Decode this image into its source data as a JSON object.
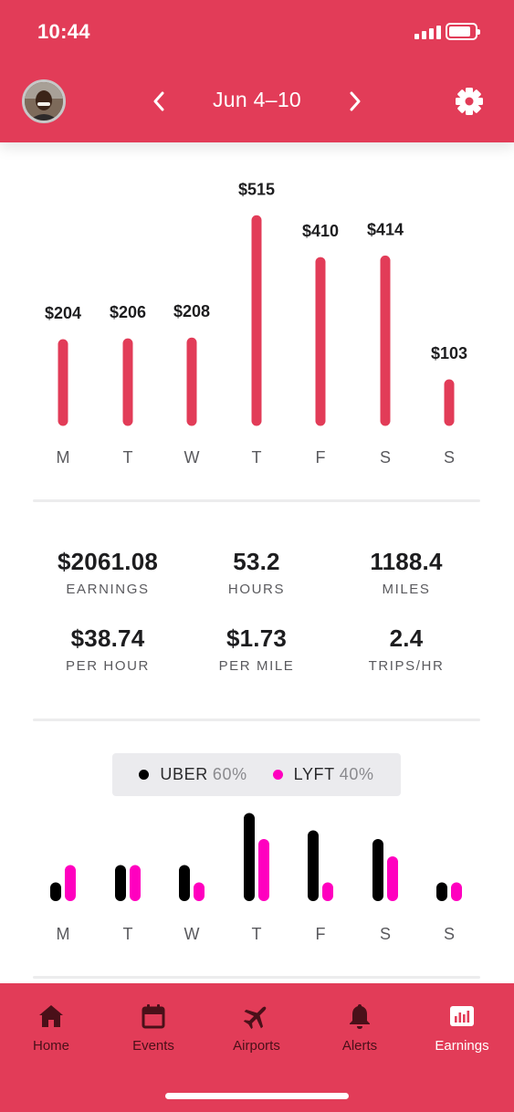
{
  "status_bar": {
    "time": "10:44",
    "battery_level": 0.85
  },
  "header": {
    "week_label": "Jun 4–10",
    "prev_icon": "chevron-left-icon",
    "next_icon": "chevron-right-icon",
    "settings_icon": "gear-icon",
    "avatar_icon": "user-avatar"
  },
  "colors": {
    "brand": "#e23c58",
    "uber": "#000000",
    "lyft": "#ff00bf",
    "tab_inactive": "#4a1019",
    "tab_active": "#ffffff"
  },
  "chart_data": [
    {
      "type": "bar",
      "categories": [
        "M",
        "T",
        "W",
        "T",
        "F",
        "S",
        "S"
      ],
      "values": [
        204,
        206,
        208,
        515,
        410,
        414,
        103
      ],
      "value_labels": [
        "$204",
        "$206",
        "$208",
        "$515",
        "$410",
        "$414",
        "$103"
      ]
    },
    {
      "type": "bar",
      "categories": [
        "M",
        "T",
        "W",
        "T",
        "F",
        "S",
        "S"
      ],
      "series": [
        {
          "name": "UBER",
          "values": [
            1,
            3,
            3,
            9,
            7,
            6,
            1
          ]
        },
        {
          "name": "LYFT",
          "values": [
            3,
            3,
            1,
            6,
            1,
            4,
            1
          ]
        }
      ]
    }
  ],
  "stats": [
    {
      "value": "$2061.08",
      "label": "EARNINGS"
    },
    {
      "value": "53.2",
      "label": "HOURS"
    },
    {
      "value": "1188.4",
      "label": "MILES"
    },
    {
      "value": "$38.74",
      "label": "PER HOUR"
    },
    {
      "value": "$1.73",
      "label": "PER MILE"
    },
    {
      "value": "2.4",
      "label": "TRIPS/HR"
    }
  ],
  "share_legend": [
    {
      "name": "UBER",
      "pct": "60%"
    },
    {
      "name": "LYFT",
      "pct": "40%"
    }
  ],
  "tabs": [
    {
      "label": "Home",
      "icon": "home-icon"
    },
    {
      "label": "Events",
      "icon": "calendar-icon"
    },
    {
      "label": "Airports",
      "icon": "airplane-icon"
    },
    {
      "label": "Alerts",
      "icon": "bell-icon"
    },
    {
      "label": "Earnings",
      "icon": "bar-chart-icon",
      "active": true
    }
  ]
}
